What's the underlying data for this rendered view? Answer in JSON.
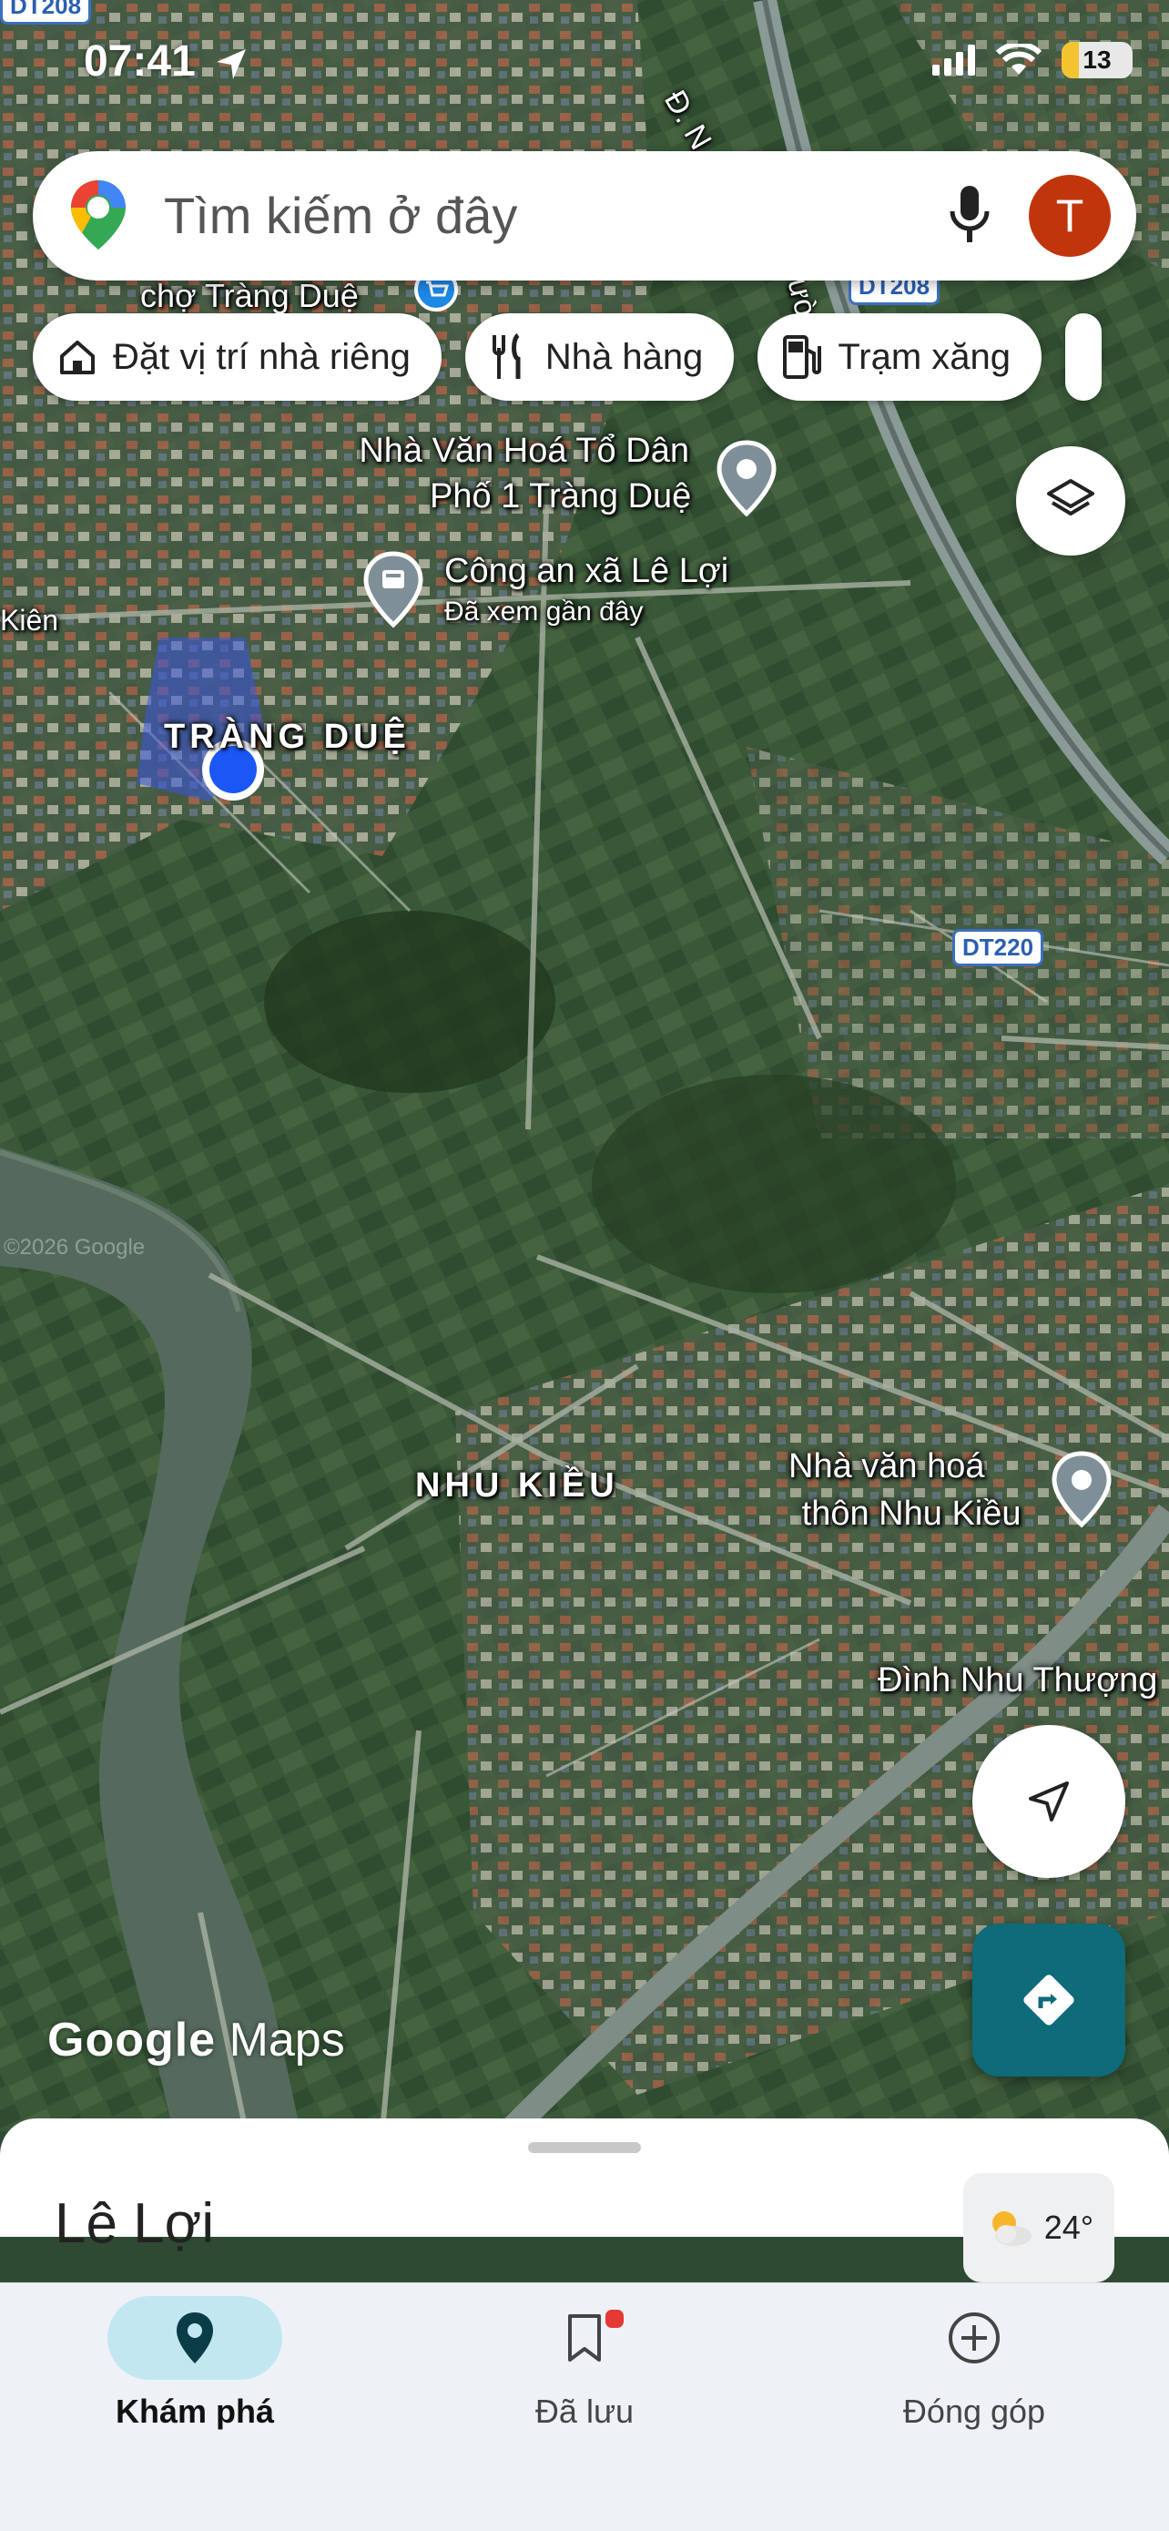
{
  "status_bar": {
    "time": "07:41",
    "battery": "13"
  },
  "search": {
    "placeholder": "Tìm kiếm ở đây",
    "avatar_letter": "T"
  },
  "chips": [
    {
      "label": "Đặt vị trí nhà riêng",
      "icon": "home-icon"
    },
    {
      "label": "Nhà hàng",
      "icon": "restaurant-icon"
    },
    {
      "label": "Trạm xăng",
      "icon": "gas-station-icon"
    }
  ],
  "map": {
    "labels": {
      "cho_trang_due": "chợ Tràng Duệ",
      "nha_van_hoa_1": "Nhà Văn Hoá Tổ Dân",
      "nha_van_hoa_1_line2": "Phố 1 Tràng Duệ",
      "cong_an": "Công an xã Lê Lợi",
      "cong_an_sub": "Đã xem gần đây",
      "trang_due": "TRÀNG DUỆ",
      "kien": "Kiên",
      "nhu_kieu": "NHU KIỀU",
      "nha_van_hoa_nhu_kieu": "Nhà văn hoá",
      "nha_van_hoa_nhu_kieu_line2": "thôn Nhu Kiều",
      "dinh_nhu_thuong": "Đình Nhu Thượng",
      "road_dn": "Đ. N",
      "road_duong": "ường s"
    },
    "shields": {
      "dt208_top": "DT208",
      "dt208": "DT208",
      "dt220": "DT220"
    },
    "copyright": "©2026 Google",
    "logo": {
      "google": "Google",
      "maps": "Maps"
    }
  },
  "sheet": {
    "title": "Lê Lợi",
    "weather": "24°",
    "weather_icon": "partly-cloudy-icon"
  },
  "nav": [
    {
      "label": "Khám phá",
      "icon": "explore-pin-icon",
      "active": true
    },
    {
      "label": "Đã lưu",
      "icon": "bookmark-icon",
      "active": false
    },
    {
      "label": "Đóng góp",
      "icon": "add-circle-icon",
      "active": false
    }
  ],
  "colors": {
    "accent": "#0d6b7a",
    "avatar": "#c1350d",
    "location_dot": "#1a57f5",
    "nav_active": "#c2e7f1"
  }
}
